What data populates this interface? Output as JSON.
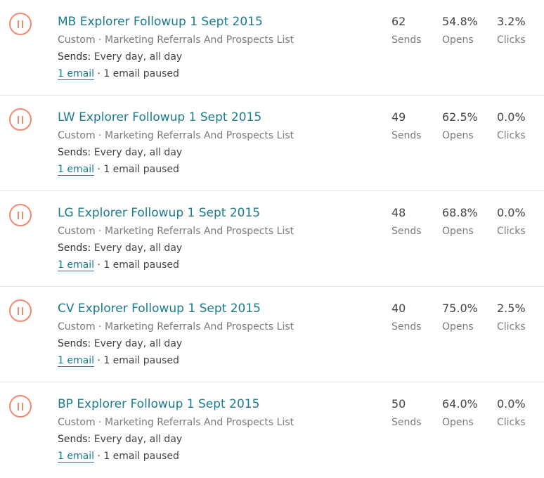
{
  "campaigns": [
    {
      "title": "MB Explorer Followup 1 Sept 2015",
      "subtitle": "Custom · Marketing Referrals And Prospects List",
      "schedule_label": "Sends:",
      "schedule_value": "Every day, all day",
      "email_link": "1 email",
      "email_status": " · 1 email paused",
      "sends": "62",
      "sends_label": "Sends",
      "opens": "54.8%",
      "opens_label": "Opens",
      "clicks": "3.2%",
      "clicks_label": "Clicks"
    },
    {
      "title": "LW Explorer Followup 1 Sept 2015",
      "subtitle": "Custom · Marketing Referrals And Prospects List",
      "schedule_label": "Sends:",
      "schedule_value": "Every day, all day",
      "email_link": "1 email",
      "email_status": " · 1 email paused",
      "sends": "49",
      "sends_label": "Sends",
      "opens": "62.5%",
      "opens_label": "Opens",
      "clicks": "0.0%",
      "clicks_label": "Clicks"
    },
    {
      "title": "LG Explorer Followup 1 Sept 2015",
      "subtitle": "Custom · Marketing Referrals And Prospects List",
      "schedule_label": "Sends:",
      "schedule_value": "Every day, all day",
      "email_link": "1 email",
      "email_status": " · 1 email paused",
      "sends": "48",
      "sends_label": "Sends",
      "opens": "68.8%",
      "opens_label": "Opens",
      "clicks": "0.0%",
      "clicks_label": "Clicks"
    },
    {
      "title": "CV Explorer Followup 1 Sept 2015",
      "subtitle": "Custom · Marketing Referrals And Prospects List",
      "schedule_label": "Sends:",
      "schedule_value": "Every day, all day",
      "email_link": "1 email",
      "email_status": " · 1 email paused",
      "sends": "40",
      "sends_label": "Sends",
      "opens": "75.0%",
      "opens_label": "Opens",
      "clicks": "2.5%",
      "clicks_label": "Clicks"
    },
    {
      "title": "BP Explorer Followup 1 Sept 2015",
      "subtitle": "Custom · Marketing Referrals And Prospects List",
      "schedule_label": "Sends:",
      "schedule_value": "Every day, all day",
      "email_link": "1 email",
      "email_status": " · 1 email paused",
      "sends": "50",
      "sends_label": "Sends",
      "opens": "64.0%",
      "opens_label": "Opens",
      "clicks": "0.0%",
      "clicks_label": "Clicks"
    }
  ],
  "icons": {
    "pause": "pause-icon"
  },
  "colors": {
    "title": "#1a7c8b",
    "pause_accent": "#ef8a70",
    "divider": "#e6e6e6"
  }
}
